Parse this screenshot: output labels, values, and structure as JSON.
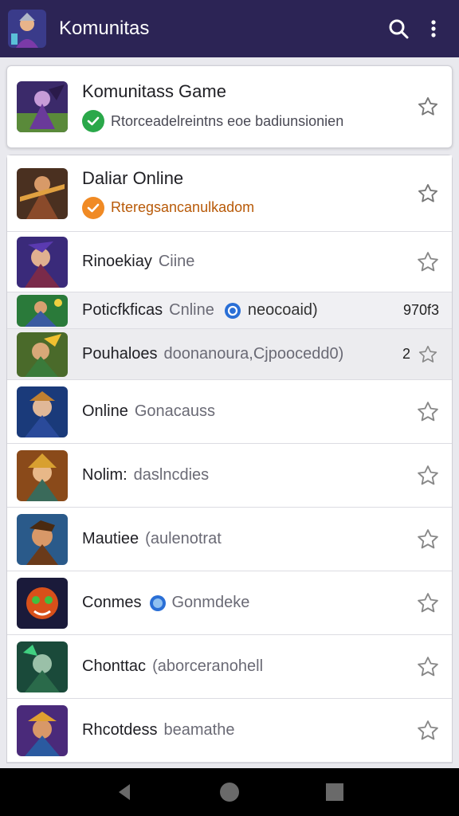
{
  "appbar": {
    "title": "Komunitas",
    "app_icon": "game-avatar-icon",
    "actions": [
      "search-icon",
      "more-vert-icon"
    ]
  },
  "top_card": {
    "title": "Komunitass Game",
    "subtitle": "Rtorceadelreintns eoe badiunsionien",
    "badge": "check-circle-icon",
    "badge_color": "#2aa84a",
    "star": "star-outline-icon"
  },
  "group": {
    "first": {
      "title": "Daliar Online",
      "subtitle": "Rteregsancanulkadom",
      "badge": "check-circle-icon",
      "badge_color": "#f08a24",
      "star": "star-outline-icon"
    },
    "rows": [
      {
        "title": "Rinoekiay",
        "detail": "Ciine",
        "trail": "",
        "icon": "game-avatar-icon"
      },
      {
        "title": "Poticfkficas",
        "detail": "Cnline",
        "badge_text": "neocoaid)",
        "trail": "970f3",
        "icon": "game-avatar-icon"
      },
      {
        "title": "Pouhaloes",
        "detail": "doonanoura,Cjpoocedd0)",
        "trail": "2",
        "icon": "game-avatar-icon"
      },
      {
        "title": "Online",
        "detail": "Gonacauss",
        "trail": "",
        "icon": "game-avatar-icon"
      },
      {
        "title": "Nolim:",
        "detail": "daslncdies",
        "trail": "",
        "icon": "game-avatar-icon"
      },
      {
        "title": "Mautiee",
        "detail": "(aulenotrat",
        "trail": "",
        "icon": "game-avatar-icon"
      },
      {
        "title": "Conmes",
        "detail": "Gonmdeke",
        "trail": "",
        "icon": "game-avatar-icon"
      },
      {
        "title": "Chonttac",
        "detail": "(aborceranohell",
        "trail": "",
        "icon": "game-avatar-icon"
      },
      {
        "title": "Rhcotdess",
        "detail": "beamathe",
        "trail": "",
        "icon": "game-avatar-icon"
      }
    ]
  },
  "colors": {
    "appbar": "#2c2455",
    "accent_blue": "#2a6fd6",
    "check_green": "#2aa84a",
    "check_orange": "#f08a24"
  },
  "navbar": {
    "buttons": [
      "back-icon",
      "home-icon",
      "recents-icon"
    ]
  }
}
